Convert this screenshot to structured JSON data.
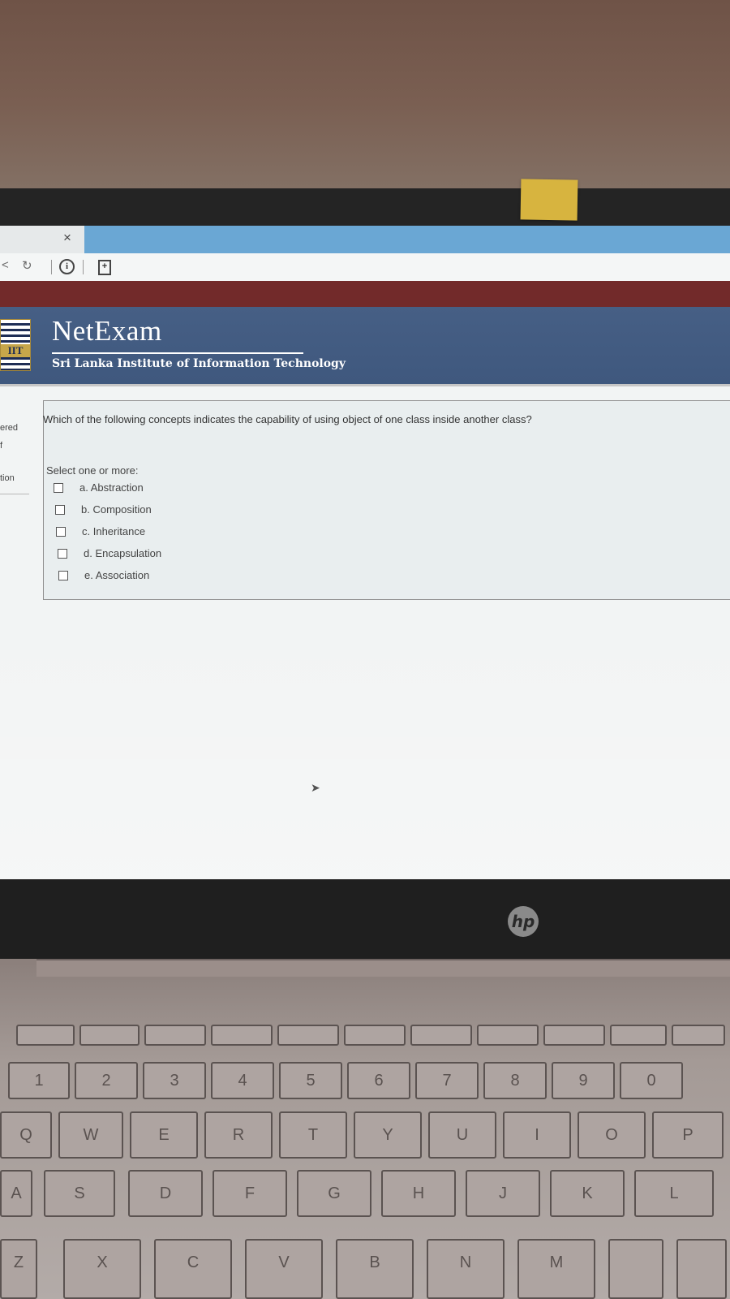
{
  "browser": {
    "tab_close": "×",
    "info": "i",
    "page": "+"
  },
  "header": {
    "logo_text": "IIT",
    "title": "NetExam",
    "subtitle": "Sri Lanka Institute of Information Technology"
  },
  "sidebar": {
    "fragments": [
      "ered",
      "f",
      "tion"
    ]
  },
  "quiz": {
    "question": "Which of the following concepts indicates the capability of using object of one class inside another class?",
    "prompt": "Select one or more:",
    "options": [
      {
        "label": "a. Abstraction",
        "checked": false
      },
      {
        "label": "b. Composition",
        "checked": false
      },
      {
        "label": "c. Inheritance",
        "checked": false
      },
      {
        "label": "d. Encapsulation",
        "checked": false
      },
      {
        "label": "e. Association",
        "checked": false
      }
    ]
  },
  "laptop": {
    "brand": "hp"
  },
  "keyboard": {
    "number_row": [
      "1",
      "2",
      "3",
      "4",
      "5",
      "6",
      "7",
      "8",
      "9",
      "0"
    ],
    "top_row": [
      "Q",
      "W",
      "E",
      "R",
      "T",
      "Y",
      "U",
      "I",
      "O",
      "P"
    ],
    "home_row": [
      "A",
      "S",
      "D",
      "F",
      "G",
      "H",
      "J",
      "K",
      "L"
    ],
    "bottom_row": [
      "Z",
      "X",
      "C",
      "V",
      "B",
      "N",
      "M"
    ]
  },
  "colors": {
    "header_blue": "#465f85",
    "header_red": "#722a2a",
    "tab_blue": "#6aa7d4"
  }
}
